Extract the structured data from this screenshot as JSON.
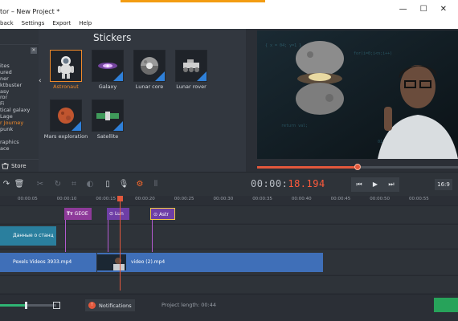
{
  "window": {
    "title": "tor – New Project *",
    "controls": [
      "—",
      "☐",
      "✕"
    ]
  },
  "menu": [
    "back",
    "Settings",
    "Export",
    "Help"
  ],
  "categories": {
    "items": [
      "ites",
      "ured",
      "ner",
      "ktbuster",
      "asy",
      "ror",
      "Fi",
      "tical galaxy",
      "Lage",
      "r Journey",
      "punk",
      "",
      "raphics",
      "ace"
    ],
    "active_index": 9,
    "store_label": "Store"
  },
  "stickers": {
    "title": "Stickers",
    "items": [
      {
        "label": "Astronaut",
        "selected": true,
        "download": false
      },
      {
        "label": "Galaxy",
        "selected": false,
        "download": true
      },
      {
        "label": "Lunar core",
        "selected": false,
        "download": true
      },
      {
        "label": "Lunar rover",
        "selected": false,
        "download": true
      },
      {
        "label": "Mars exploration",
        "selected": false,
        "download": true
      },
      {
        "label": "Satellite",
        "selected": false,
        "download": true
      }
    ]
  },
  "preview": {
    "progress": 0.5
  },
  "toolbar": {
    "timecode_main": "00:00:",
    "timecode_red": "18.194",
    "aspect_ratio": "16:9"
  },
  "ruler": {
    "ticks": [
      "00:00:05",
      "00:00:10",
      "00:00:15",
      "00:00:20",
      "00:00:25",
      "00:00:30",
      "00:00:35",
      "00:00:40",
      "00:00:45",
      "00:00:50",
      "00:00:55"
    ]
  },
  "timeline": {
    "title_clip": "GEOE",
    "sticker_clips": [
      "Lun",
      "Astr"
    ],
    "text_clip": "Данные о станц",
    "video_clips": [
      "Pexels Videos 3933.mp4",
      "video (2).mp4"
    ]
  },
  "status": {
    "zoom": 0.45,
    "notifications_label": "Notifications",
    "notifications_count": "!",
    "project_length": "Project length:  00:44"
  },
  "colors": {
    "accent": "#f08a2a",
    "playhead": "#e2583c",
    "sticker_clip": "#6e3ea6",
    "video_clip": "#3f6fb8",
    "text_clip": "#2a7f9e"
  }
}
